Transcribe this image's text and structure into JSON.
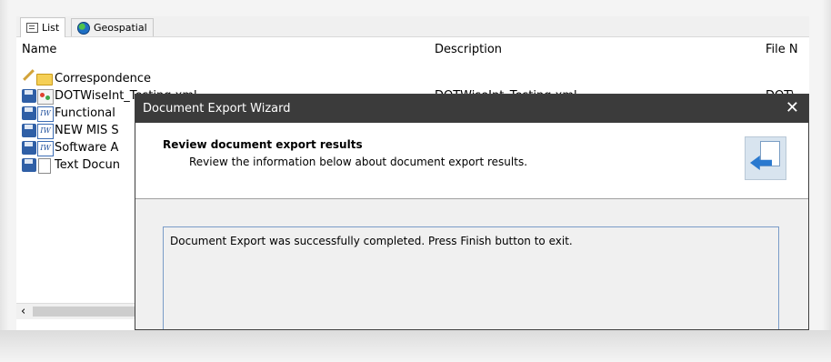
{
  "tabs": [
    {
      "label": "List",
      "icon": "list-icon"
    },
    {
      "label": "Geospatial",
      "icon": "globe-icon"
    }
  ],
  "columns": [
    "Name",
    "Description",
    "File N"
  ],
  "rows": [
    {
      "name": "Correspondence",
      "description": "",
      "file": "",
      "icons": [
        "pencil-icon",
        "folder-icon"
      ]
    },
    {
      "name": "DOTWiseInt_Testing.xml",
      "description": "DOTWiseInt_Testing.xml",
      "file": "DOT\\",
      "icons": [
        "disk-icon",
        "xml-icon"
      ]
    },
    {
      "name": "Functional",
      "description": "",
      "file": "",
      "icons": [
        "disk-icon",
        "iw-document-icon"
      ]
    },
    {
      "name": "NEW MIS S",
      "description": "",
      "file": "",
      "icons": [
        "disk-icon",
        "iw-document-icon"
      ]
    },
    {
      "name": "Software A",
      "description": "",
      "file": "",
      "icons": [
        "disk-icon",
        "iw-document-icon"
      ]
    },
    {
      "name": "Text Docun",
      "description": "",
      "file": "",
      "icons": [
        "disk-icon",
        "text-document-icon"
      ]
    }
  ],
  "scroll_left_glyph": "‹",
  "dialog": {
    "title": "Document Export Wizard",
    "close_glyph": "✕",
    "heading": "Review document export results",
    "subheading": "Review the information below about document export results.",
    "message": "Document Export was successfully completed. Press Finish button to exit."
  },
  "colors": {
    "titlebar": "#3b3b3b",
    "results_border": "#7a9cc8",
    "disk": "#2f5fa6"
  }
}
